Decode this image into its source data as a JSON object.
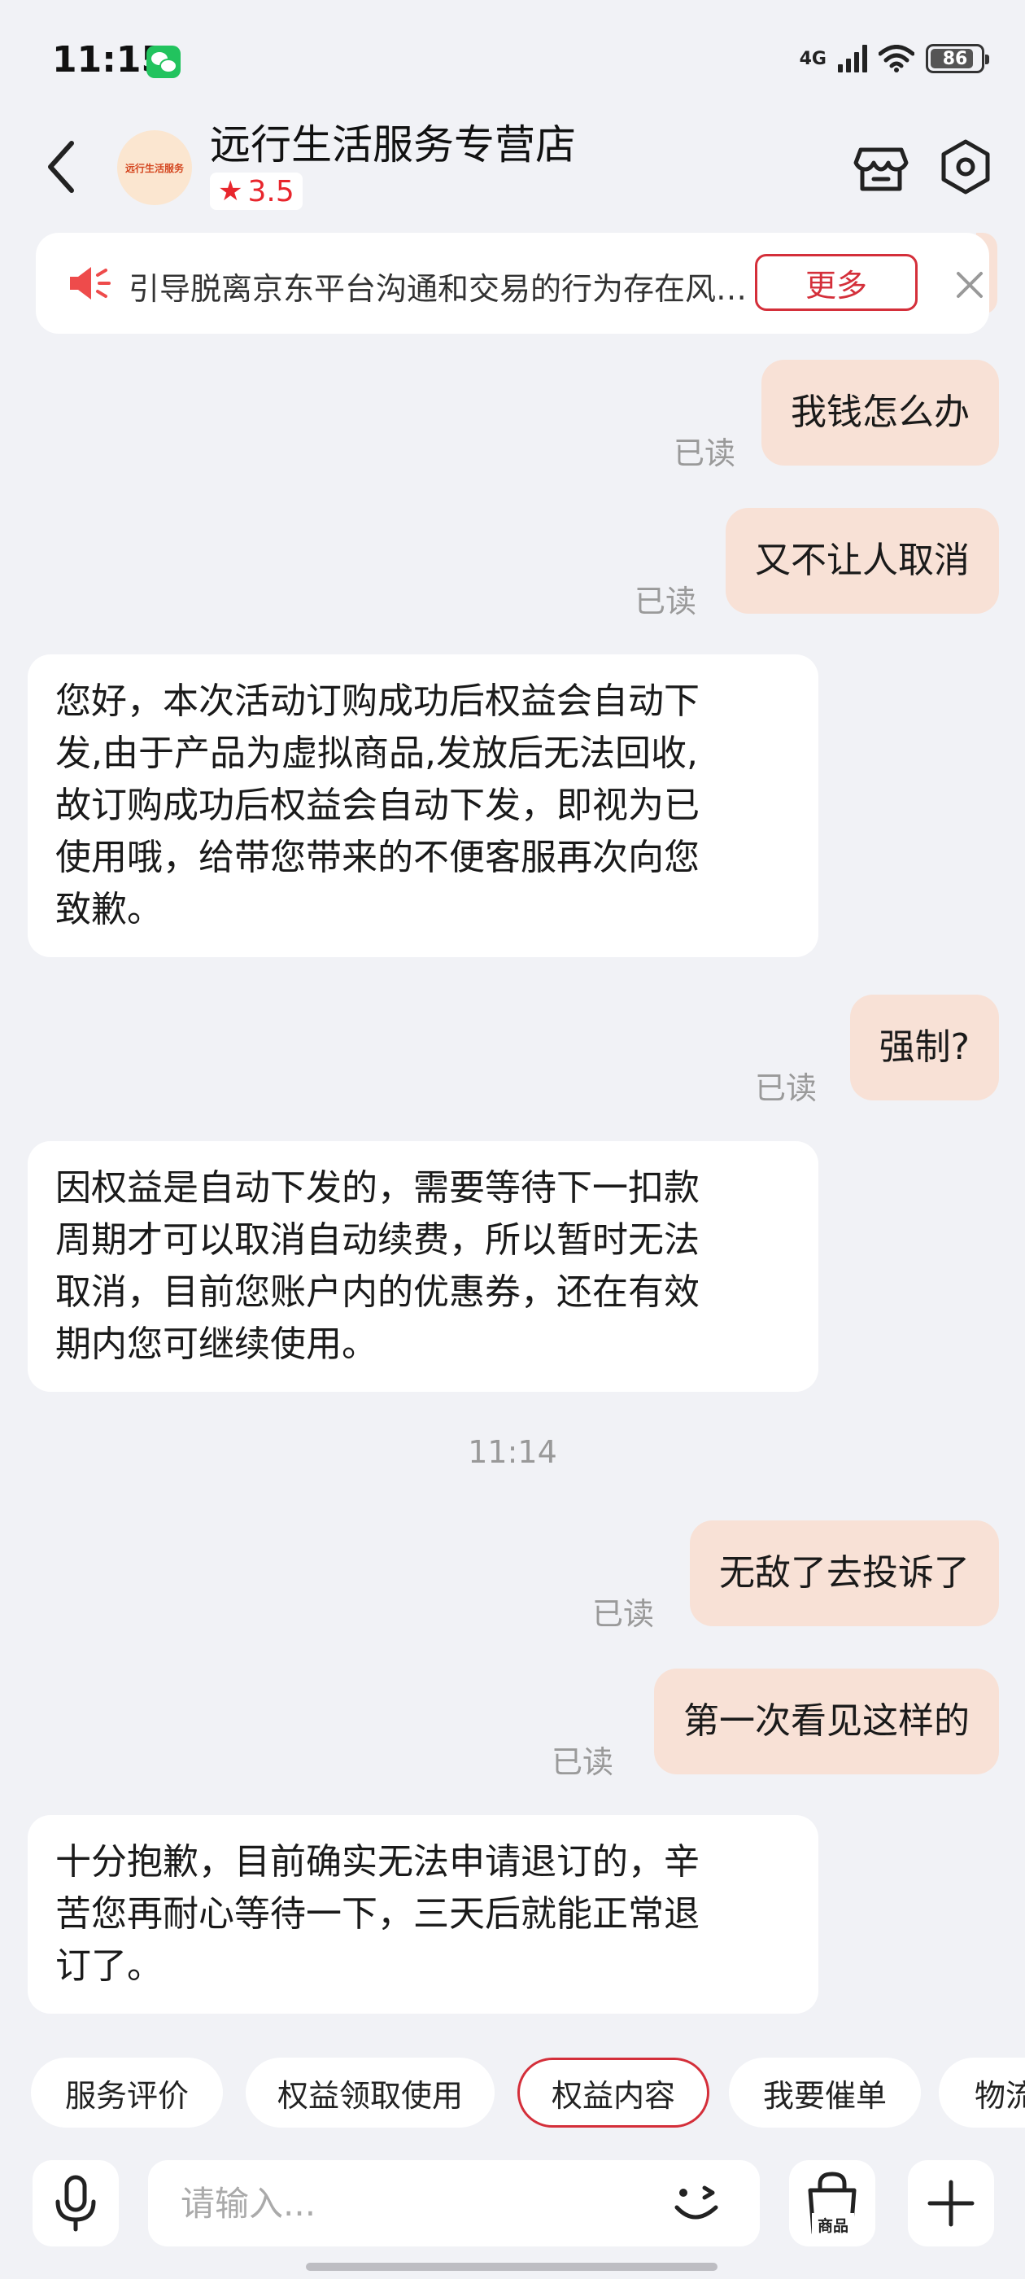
{
  "status_bar": {
    "time": "11:15",
    "network": "4G",
    "battery": "86",
    "battery_level": 0.86
  },
  "header": {
    "shop_name": "远行生活服务专营店",
    "avatar_text": "远行生活服务",
    "rating": "3.5"
  },
  "notice": {
    "text": "引导脱离京东平台沟通和交易的行为存在风险，请提高警惕",
    "more_label": "更多"
  },
  "messages": [
    {
      "side": "out",
      "text": "我钱怎么办",
      "status": "已读"
    },
    {
      "side": "out",
      "text": "又不让人取消",
      "status": "已读"
    },
    {
      "side": "in",
      "lines": [
        "您好，本次活动订购成功后权益会自动下",
        "发,由于产品为虚拟商品,发放后无法回收,",
        "故订购成功后权益会自动下发，即视为已",
        "使用哦，给带您带来的不便客服再次向您",
        "致歉。"
      ]
    },
    {
      "side": "out",
      "text": "强制?",
      "status": "已读"
    },
    {
      "side": "in",
      "lines": [
        "因权益是自动下发的，需要等待下一扣款",
        "周期才可以取消自动续费，所以暂时无法",
        "取消，目前您账户内的优惠券，还在有效",
        "期内您可继续使用。"
      ]
    },
    {
      "side": "out",
      "text": "无敌了去投诉了",
      "status": "已读"
    },
    {
      "side": "out",
      "text": "第一次看见这样的",
      "status": "已读"
    },
    {
      "side": "in",
      "lines": [
        "十分抱歉，目前确实无法申请退订的，辛",
        "苦您再耐心等待一下，三天后就能正常退",
        "订了。"
      ]
    }
  ],
  "timestamp": "11:14",
  "quick_chips": [
    "服务评价",
    "权益领取使用",
    "权益内容",
    "我要催单",
    "物流"
  ],
  "input": {
    "placeholder": "请输入...",
    "value": "",
    "goods_label": "商品"
  },
  "colors": {
    "outgoing_bubble": "#f8e1d6",
    "incoming_bubble": "#ffffff",
    "accent": "#d42f3a",
    "background": "#f1f2f6"
  }
}
